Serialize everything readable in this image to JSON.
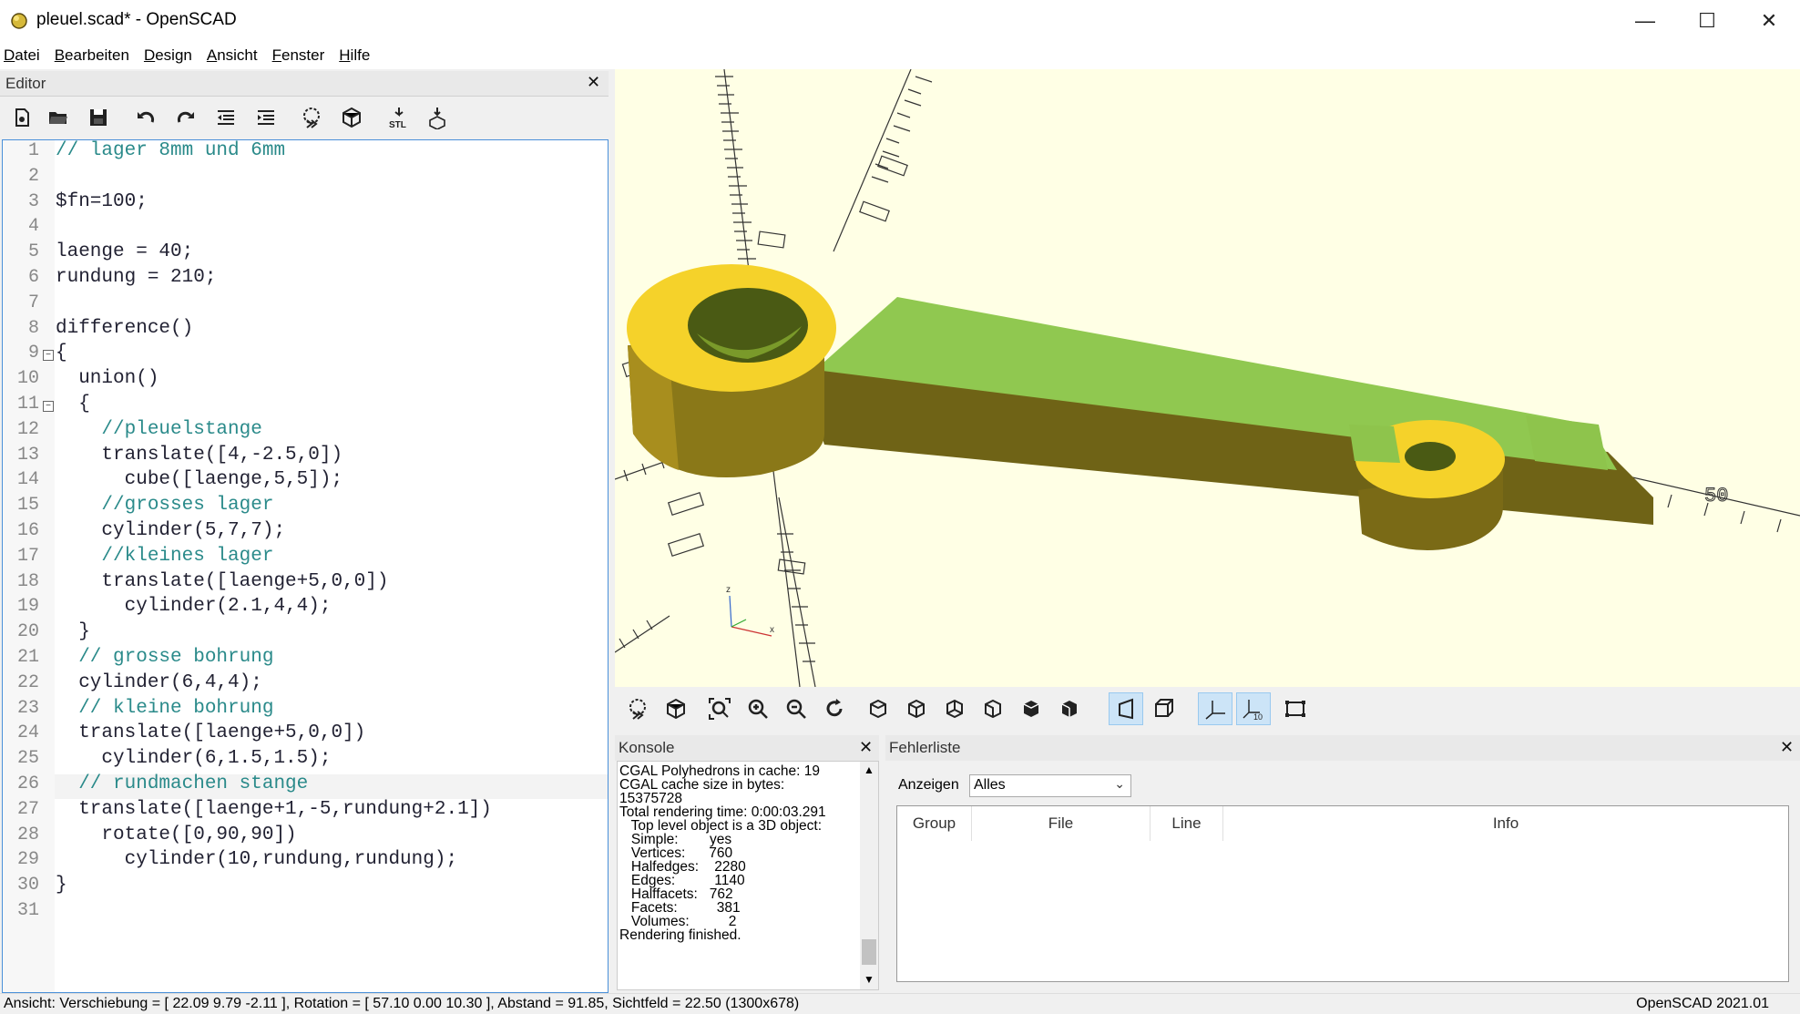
{
  "window": {
    "title": "pleuel.scad* - OpenSCAD"
  },
  "menu": [
    "Datei",
    "Bearbeiten",
    "Design",
    "Ansicht",
    "Fenster",
    "Hilfe"
  ],
  "editor": {
    "title": "Editor",
    "lines": [
      {
        "n": "1",
        "t": "// lager 8mm und 6mm",
        "c": true
      },
      {
        "n": "2",
        "t": ""
      },
      {
        "n": "3",
        "t": "$fn=100;"
      },
      {
        "n": "4",
        "t": ""
      },
      {
        "n": "5",
        "t": "laenge = 40;"
      },
      {
        "n": "6",
        "t": "rundung = 210;"
      },
      {
        "n": "7",
        "t": ""
      },
      {
        "n": "8",
        "t": "difference()"
      },
      {
        "n": "9",
        "t": "{",
        "fold": true
      },
      {
        "n": "10",
        "t": "  union()"
      },
      {
        "n": "11",
        "t": "  {",
        "fold": true
      },
      {
        "n": "12",
        "t": "    //pleuelstange",
        "c": true
      },
      {
        "n": "13",
        "t": "    translate([4,-2.5,0])"
      },
      {
        "n": "14",
        "t": "      cube([laenge,5,5]);"
      },
      {
        "n": "15",
        "t": "    //grosses lager",
        "c": true
      },
      {
        "n": "16",
        "t": "    cylinder(5,7,7);"
      },
      {
        "n": "17",
        "t": "    //kleines lager",
        "c": true
      },
      {
        "n": "18",
        "t": "    translate([laenge+5,0,0])"
      },
      {
        "n": "19",
        "t": "      cylinder(2.1,4,4);"
      },
      {
        "n": "20",
        "t": "  }"
      },
      {
        "n": "21",
        "t": "  // grosse bohrung",
        "c": true
      },
      {
        "n": "22",
        "t": "  cylinder(6,4,4);"
      },
      {
        "n": "23",
        "t": "  // kleine bohrung",
        "c": true
      },
      {
        "n": "24",
        "t": "  translate([laenge+5,0,0])"
      },
      {
        "n": "25",
        "t": "    cylinder(6,1.5,1.5);"
      },
      {
        "n": "26",
        "t": "  // rundmachen stange",
        "c": true
      },
      {
        "n": "27",
        "t": "  translate([laenge+1,-5,rundung+2.1])"
      },
      {
        "n": "28",
        "t": "    rotate([0,90,90])"
      },
      {
        "n": "29",
        "t": "      cylinder(10,rundung,rundung);"
      },
      {
        "n": "30",
        "t": "}"
      },
      {
        "n": "31",
        "t": ""
      }
    ]
  },
  "viewport": {
    "axis_label": "50"
  },
  "console": {
    "title": "Konsole",
    "lines": [
      "CGAL Polyhedrons in cache: 19",
      "CGAL cache size in bytes:",
      "15375728",
      "Total rendering time: 0:00:03.291",
      "   Top level object is a 3D object:",
      "   Simple:        yes",
      "   Vertices:      760",
      "   Halfedges:    2280",
      "   Edges:          1140",
      "   Halffacets:   762",
      "   Facets:          381",
      "   Volumes:          2",
      "Rendering finished."
    ]
  },
  "errors": {
    "title": "Fehlerliste",
    "show_label": "Anzeigen",
    "show_value": "Alles",
    "columns": [
      "Group",
      "File",
      "Line",
      "Info"
    ]
  },
  "status": {
    "left": "Ansicht: Verschiebung = [ 22.09 9.79 -2.11 ], Rotation = [ 57.10 0.00 10.30 ], Abstand = 91.85, Sichtfeld = 22.50 (1300x678)",
    "right": "OpenSCAD 2021.01"
  }
}
